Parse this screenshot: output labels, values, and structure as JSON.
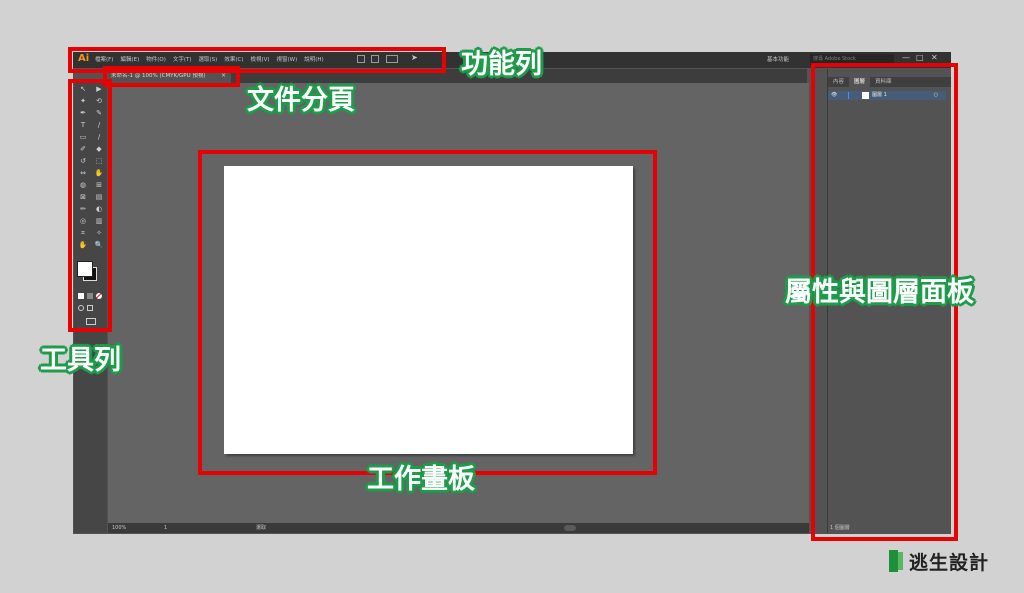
{
  "app": {
    "logo": "Ai",
    "menu": [
      "檔案(F)",
      "編輯(E)",
      "物件(O)",
      "文字(T)",
      "選取(S)",
      "效果(C)",
      "檢視(V)",
      "視窗(W)",
      "說明(H)"
    ],
    "workspace": "基本功能",
    "search_placeholder": "搜尋 Adobe Stock",
    "window_controls": [
      "—",
      "□",
      "✕"
    ]
  },
  "document": {
    "tab_title": "未命名-1 @ 100% (CMYK/GPU 預視)",
    "tab_close": "×"
  },
  "tools": [
    "↖",
    "▶",
    "✦",
    "⟲",
    "✒",
    "✎",
    "T",
    "/",
    "▭",
    "/",
    "✐",
    "◆",
    "↺",
    "⬚",
    "⇔",
    "✋",
    "◍",
    "⊞",
    "⊠",
    "▤",
    "✏",
    "◐",
    "◎",
    "▥",
    "⌗",
    "✧",
    "✋",
    "🔍"
  ],
  "status": {
    "zoom": "100%",
    "page": "1",
    "state": "選取"
  },
  "panel": {
    "tabs": [
      "內容",
      "圖層",
      "資料庫"
    ],
    "active_tab": 1,
    "layer": {
      "name": "圖層 1",
      "visibility": "👁",
      "target": "○"
    },
    "footer": "1 個圖層"
  },
  "annotations": {
    "menubar": "功能列",
    "doc_tab": "文件分頁",
    "toolbar": "工具列",
    "artboard": "工作畫板",
    "panel": "屬性與圖層面板"
  },
  "colors": {
    "highlight": "#e60000",
    "label_outline": "#1f9b4b",
    "ai_orange": "#f7931e"
  },
  "brand": {
    "name": "逃生設計",
    "icon": "book-icon"
  }
}
